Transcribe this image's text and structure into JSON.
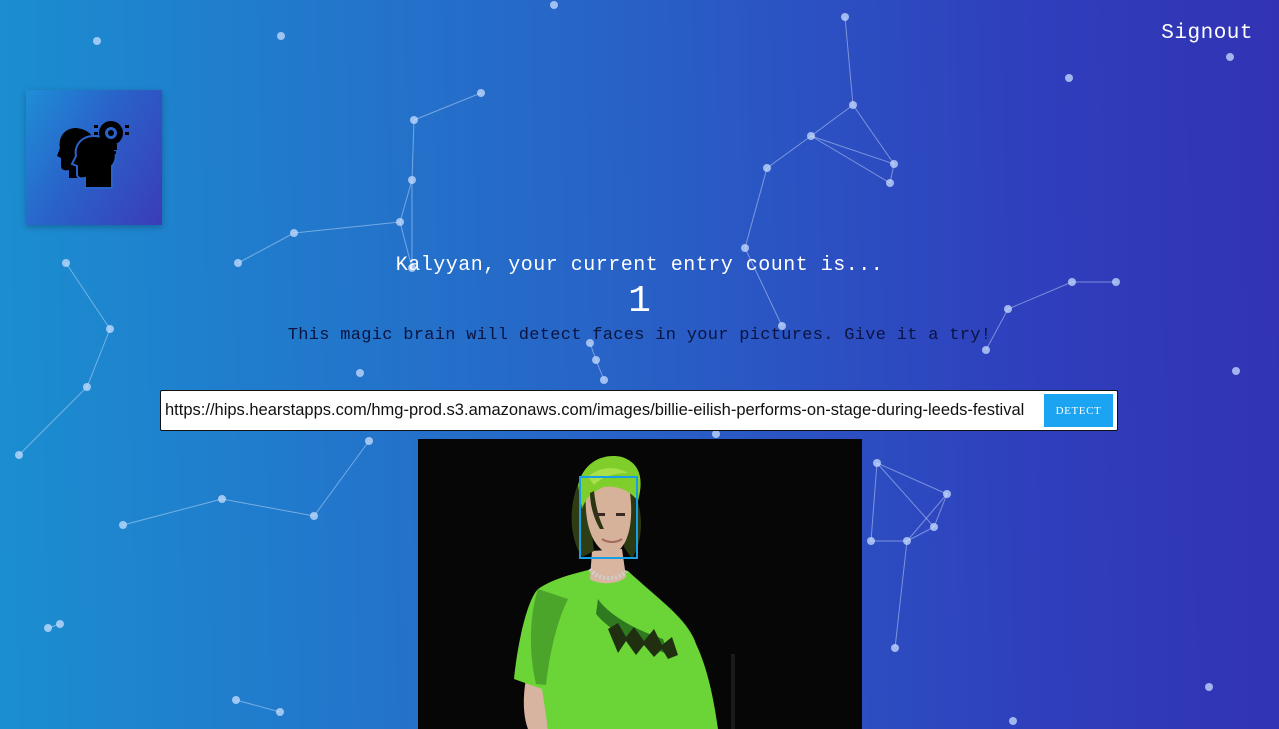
{
  "nav": {
    "signout_label": "Signout"
  },
  "logo": {
    "icon": "brain-head-icon"
  },
  "rank": {
    "greeting": "Kalyyan, your current entry count is...",
    "entry_count": "1"
  },
  "tagline": "This magic brain will detect faces in your pictures. Give it a try!",
  "image_form": {
    "url_value": "https://hips.hearstapps.com/hmg-prod.s3.amazonaws.com/images/billie-eilish-performs-on-stage-during-leeds-festival",
    "detect_label": "DETECT"
  },
  "colors": {
    "button": "#1aa4f2",
    "face_box": "#169fe6",
    "tagline_text": "#0b1440"
  }
}
